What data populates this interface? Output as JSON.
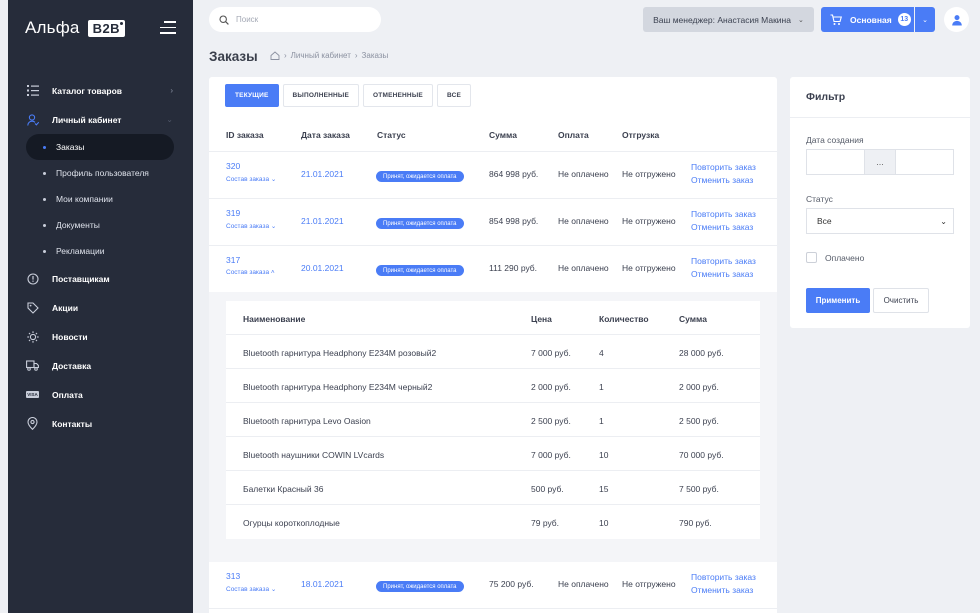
{
  "logo": {
    "text": "Альфа",
    "badge": "B2B"
  },
  "sidebar": {
    "items": [
      {
        "label": "Каталог товаров",
        "icon": "list-icon"
      },
      {
        "label": "Личный кабинет",
        "icon": "user-icon"
      },
      {
        "label": "Поставщикам",
        "icon": "info-icon"
      },
      {
        "label": "Акции",
        "icon": "tag-icon"
      },
      {
        "label": "Новости",
        "icon": "sun-icon"
      },
      {
        "label": "Доставка",
        "icon": "truck-icon"
      },
      {
        "label": "Оплата",
        "icon": "visa-icon",
        "icon_text": "VISA"
      },
      {
        "label": "Контакты",
        "icon": "location-pin-icon"
      }
    ],
    "sub_items": [
      "Заказы",
      "Профиль пользователя",
      "Мои компании",
      "Документы",
      "Рекламации"
    ]
  },
  "search": {
    "placeholder": "Поиск"
  },
  "header": {
    "manager": "Ваш менеджер: Анастасия Макина",
    "cart_label": "Основная",
    "cart_count": "13"
  },
  "page": {
    "title": "Заказы",
    "breadcrumb": [
      "Личный кабинет",
      "Заказы"
    ],
    "breadcrumb_sep": "›"
  },
  "tabs": [
    "ТЕКУЩИЕ",
    "ВЫПОЛНЕННЫЕ",
    "ОТМЕНЕННЫЕ",
    "ВСЕ"
  ],
  "orders": {
    "columns": [
      "ID заказа",
      "Дата заказа",
      "Статус",
      "Сумма",
      "Оплата",
      "Отгрузка"
    ],
    "composition_label": "Состав заказа",
    "rows": [
      {
        "id": "320",
        "date": "21.01.2021",
        "status": "Принят, ожидается оплата",
        "sum": "864 998 руб.",
        "payment": "Не оплачено",
        "shipment": "Не отгружено",
        "repeat": "Повторить заказ",
        "cancel": "Отменить заказ"
      },
      {
        "id": "319",
        "date": "21.01.2021",
        "status": "Принят, ожидается оплата",
        "sum": "854 998 руб.",
        "payment": "Не оплачено",
        "shipment": "Не отгружено",
        "repeat": "Повторить заказ",
        "cancel": "Отменить заказ"
      },
      {
        "id": "317",
        "date": "20.01.2021",
        "status": "Принят, ожидается оплата",
        "sum": "111 290 руб.",
        "payment": "Не оплачено",
        "shipment": "Не отгружено",
        "repeat": "Повторить заказ",
        "cancel": "Отменить заказ"
      },
      {
        "id": "313",
        "date": "18.01.2021",
        "status": "Принят, ожидается оплата",
        "sum": "75 200 руб.",
        "payment": "Не оплачено",
        "shipment": "Не отгружено",
        "repeat": "Повторить заказ",
        "cancel": "Отменить заказ"
      }
    ]
  },
  "details": {
    "columns": [
      "Наименование",
      "Цена",
      "Количество",
      "Сумма"
    ],
    "rows": [
      {
        "name": "Bluetooth гарнитура Headphony E234M розовый2",
        "price": "7 000 руб.",
        "qty": "4",
        "sum": "28 000 руб."
      },
      {
        "name": "Bluetooth гарнитура Headphony E234M черный2",
        "price": "2 000 руб.",
        "qty": "1",
        "sum": "2 000 руб."
      },
      {
        "name": "Bluetooth гарнитура Levo Oasion",
        "price": "2 500 руб.",
        "qty": "1",
        "sum": "2 500 руб."
      },
      {
        "name": "Bluetooth наушники COWIN LVcards",
        "price": "7 000 руб.",
        "qty": "10",
        "sum": "70 000 руб."
      },
      {
        "name": "Балетки Красный 36",
        "price": "500 руб.",
        "qty": "15",
        "sum": "7 500 руб."
      },
      {
        "name": "Огурцы короткоплодные",
        "price": "79 руб.",
        "qty": "10",
        "sum": "790 руб."
      }
    ]
  },
  "filter": {
    "title": "Фильтр",
    "date_label": "Дата создания",
    "date_separator": "...",
    "status_label": "Статус",
    "status_value": "Все",
    "paid_label": "Оплачено",
    "apply": "Применить",
    "clear": "Очистить"
  },
  "colors": {
    "accent": "#4a7cf6",
    "sidebar": "#262c3a",
    "background": "#eef0f4"
  }
}
